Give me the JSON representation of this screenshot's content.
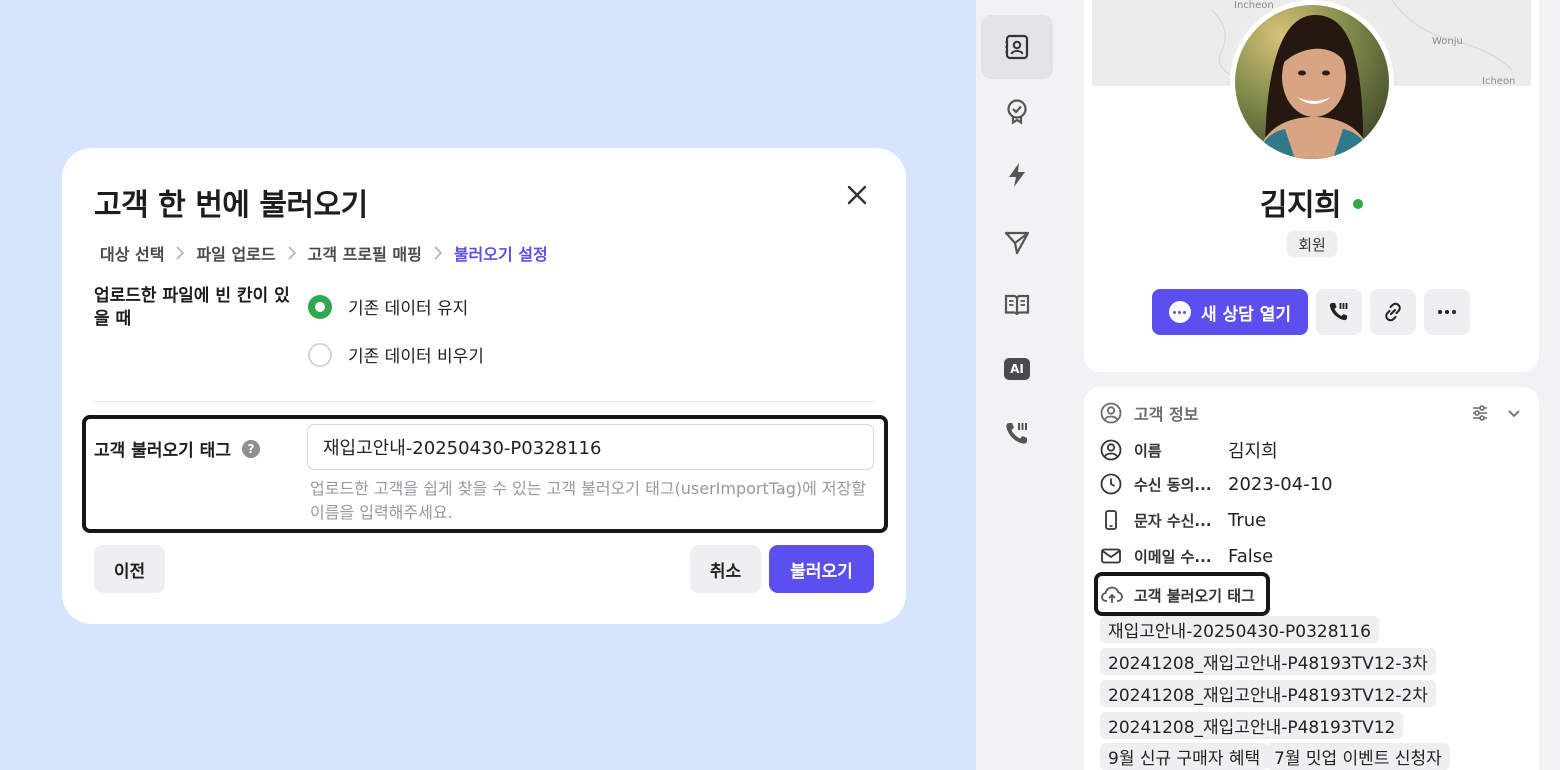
{
  "modal": {
    "title": "고객 한 번에 불러오기",
    "breadcrumbs": [
      "대상 선택",
      "파일 업로드",
      "고객 프로필 매핑",
      "불러오기 설정"
    ],
    "empty_cell_label": "업로드한 파일에 빈 칸이 있을 때",
    "options": [
      "기존 데이터 유지",
      "기존 데이터 비우기"
    ],
    "selected_option": "기존 데이터 유지",
    "tag_label": "고객 불러오기 태그",
    "tag_value": "재입고안내-20250430-P0328116",
    "tag_help": "업로드한 고객을 쉽게 찾을 수 있는 고객 불러오기 태그(userImportTag)에 저장할 이름을 입력해주세요.",
    "buttons": {
      "prev": "이전",
      "cancel": "취소",
      "import": "불러오기"
    }
  },
  "rail": {
    "items": [
      "contact-card-icon",
      "badge-check-icon",
      "lightning-icon",
      "send-icon",
      "book-icon",
      "ai-icon",
      "phone-icon"
    ],
    "ai_label": "AI",
    "active": "contact-card-icon"
  },
  "profile": {
    "map_labels": [
      "Incheon",
      "Wonju",
      "Icheon"
    ],
    "name": "김지희",
    "status_color": "#2fa84f",
    "member_badge": "회원",
    "consult_button": "새 상담 열기"
  },
  "customer_info": {
    "header": "고객 정보",
    "fields": [
      {
        "key": "이름",
        "value": "김지희"
      },
      {
        "key": "수신 동의...",
        "value": "2023-04-10"
      },
      {
        "key": "문자 수신...",
        "value": "True"
      },
      {
        "key": "이메일 수...",
        "value": "False"
      }
    ],
    "tag_field_label": "고객 불러오기 태그",
    "tags": [
      "재입고안내-20250430-P0328116",
      "20241208_재입고안내-P48193TV12-3차",
      "20241208_재입고안내-P48193TV12-2차",
      "20241208_재입고안내-P48193TV12",
      "9월 신규 구매자 혜택",
      "7월 밋업 이벤트 신청자"
    ]
  },
  "colors": {
    "accent": "#5b4ff0",
    "success": "#2fa84f",
    "background": "#d7e4fd"
  }
}
